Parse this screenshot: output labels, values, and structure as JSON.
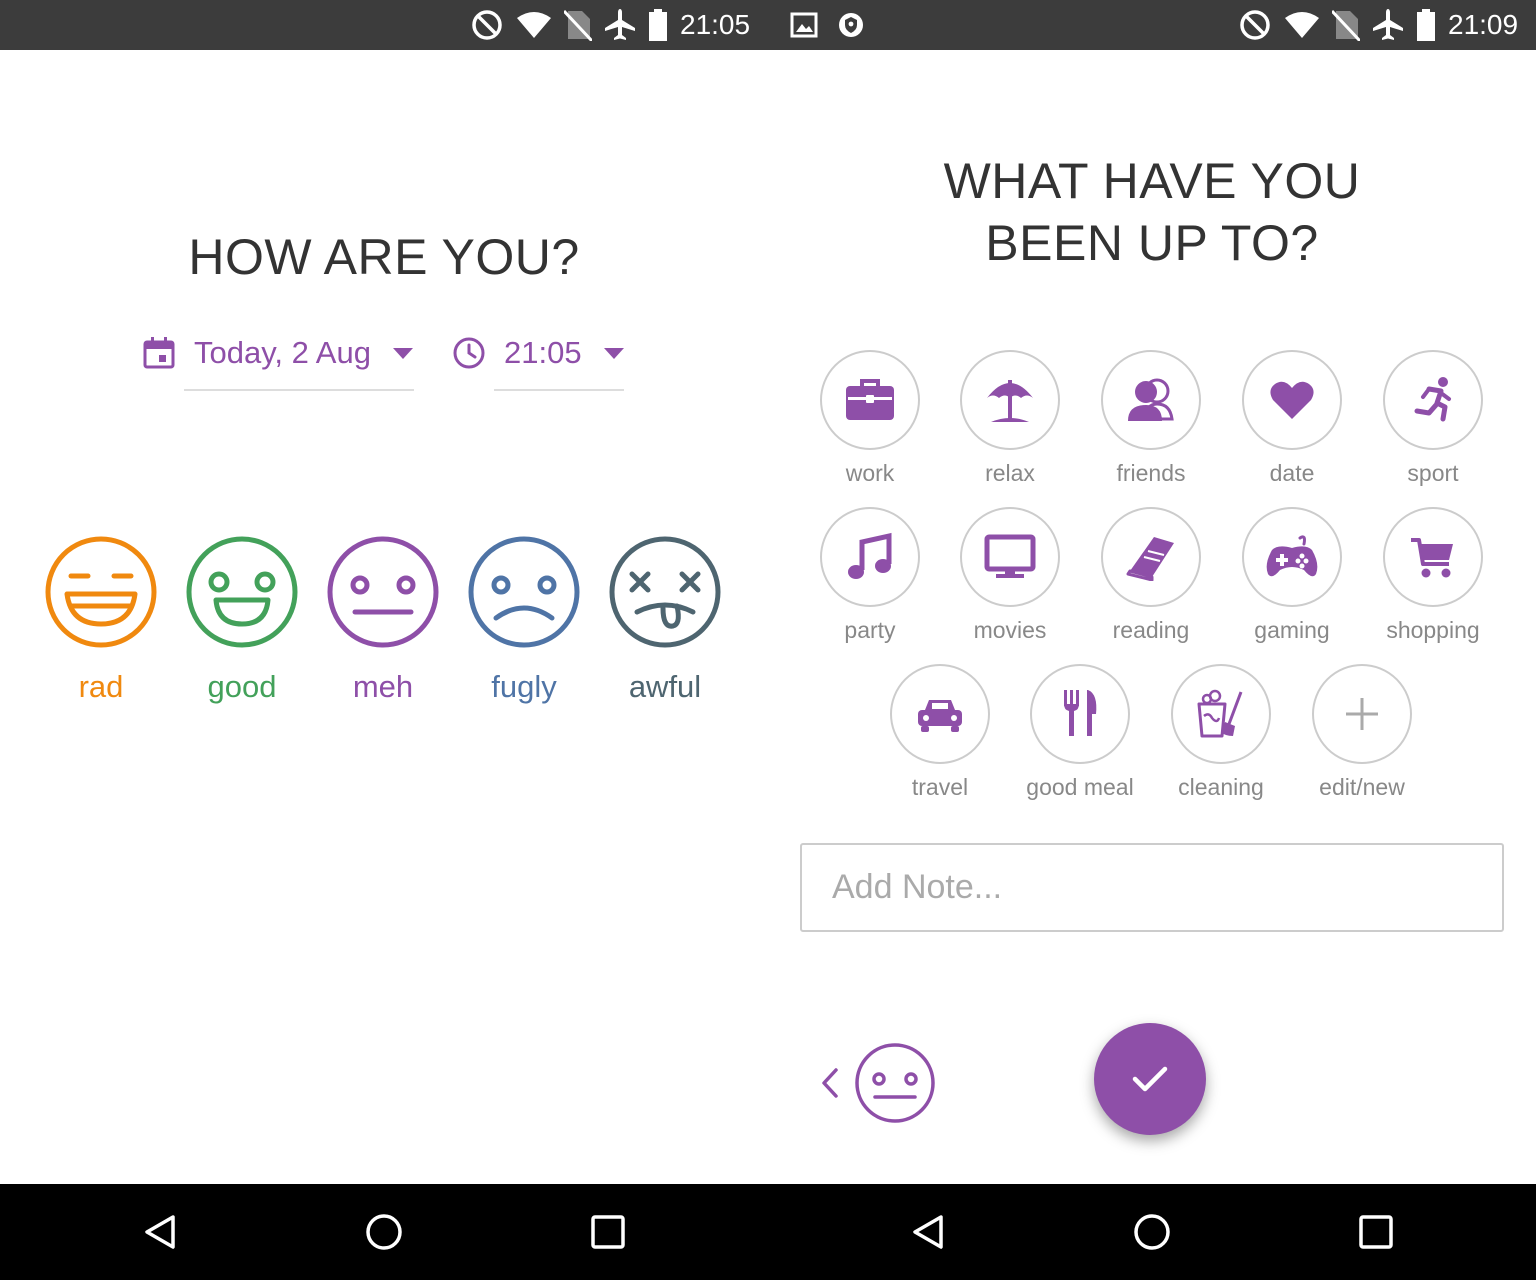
{
  "status_left": {
    "time": "21:05"
  },
  "status_right": {
    "time": "21:09"
  },
  "left": {
    "title": "HOW ARE YOU?",
    "date_value": "Today, 2 Aug",
    "time_value": "21:05",
    "moods": [
      {
        "label": "rad",
        "color": "#f0890f",
        "icon": "rad-face-icon"
      },
      {
        "label": "good",
        "color": "#43a15a",
        "icon": "good-face-icon"
      },
      {
        "label": "meh",
        "color": "#8e4fa8",
        "icon": "meh-face-icon"
      },
      {
        "label": "fugly",
        "color": "#4f74a6",
        "icon": "fugly-face-icon"
      },
      {
        "label": "awful",
        "color": "#4e6570",
        "icon": "awful-face-icon"
      }
    ]
  },
  "right": {
    "title_line1": "WHAT HAVE YOU",
    "title_line2": "BEEN UP TO?",
    "activities": [
      {
        "label": "work",
        "icon": "briefcase-icon"
      },
      {
        "label": "relax",
        "icon": "beach-umbrella-icon"
      },
      {
        "label": "friends",
        "icon": "friends-icon"
      },
      {
        "label": "date",
        "icon": "heart-icon"
      },
      {
        "label": "sport",
        "icon": "running-icon"
      },
      {
        "label": "party",
        "icon": "music-note-icon"
      },
      {
        "label": "movies",
        "icon": "tv-icon"
      },
      {
        "label": "reading",
        "icon": "book-icon"
      },
      {
        "label": "gaming",
        "icon": "gamepad-icon"
      },
      {
        "label": "shopping",
        "icon": "cart-icon"
      },
      {
        "label": "travel",
        "icon": "car-icon"
      },
      {
        "label": "good meal",
        "icon": "fork-knife-icon"
      },
      {
        "label": "cleaning",
        "icon": "cleaning-icon"
      },
      {
        "label": "edit/new",
        "icon": "plus-icon"
      }
    ],
    "note_placeholder": "Add Note...",
    "selected_mood_icon": "meh-face-icon"
  },
  "accent": "#8e4fa8"
}
